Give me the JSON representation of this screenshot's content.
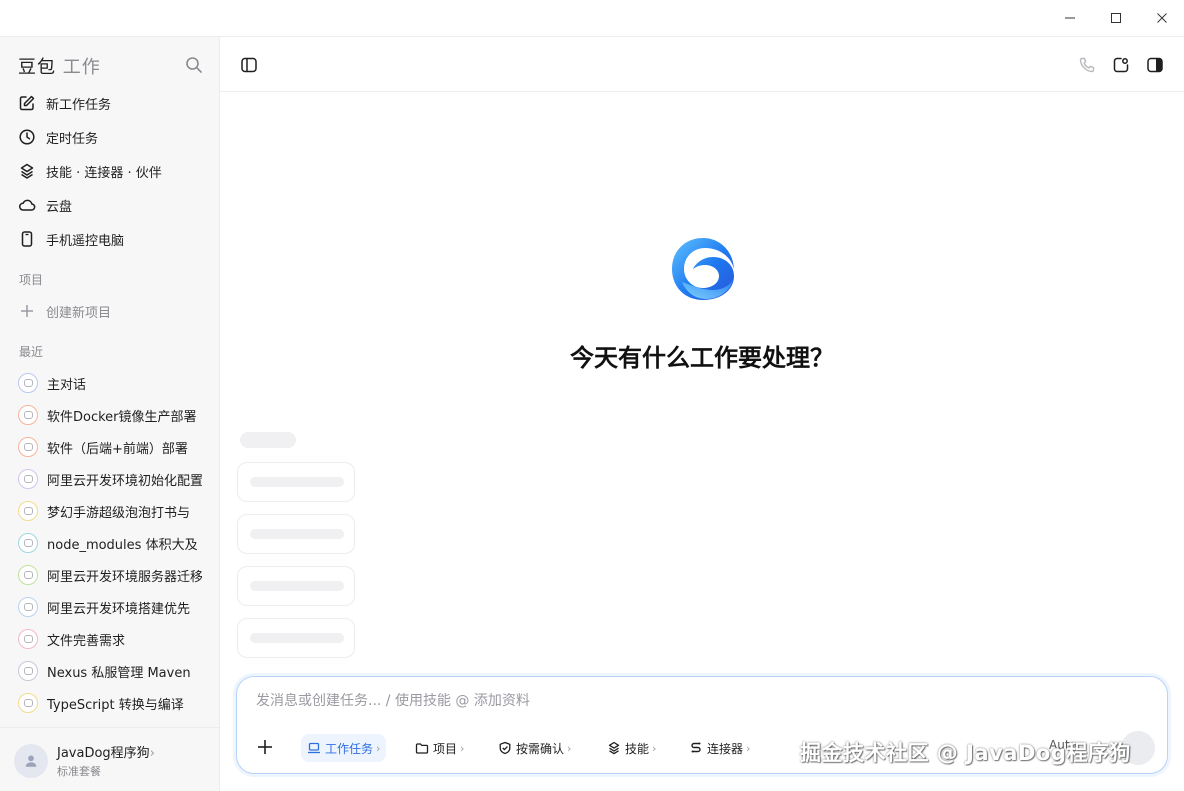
{
  "window": {
    "controls": [
      "minimize",
      "maximize",
      "close"
    ]
  },
  "sidebar": {
    "brand_main": "豆包",
    "brand_sub": "工作",
    "nav": [
      {
        "label": "新工作任务",
        "icon": "edit-icon"
      },
      {
        "label": "定时任务",
        "icon": "clock-icon"
      },
      {
        "label": "技能 · 连接器 · 伙伴",
        "icon": "layers-icon"
      },
      {
        "label": "云盘",
        "icon": "cloud-icon"
      },
      {
        "label": "手机遥控电脑",
        "icon": "phone-icon"
      }
    ],
    "projects_label": "项目",
    "create_project": "创建新项目",
    "recent_label": "最近",
    "recent": [
      {
        "label": "主对话",
        "color": "#b9c8f0"
      },
      {
        "label": "软件Docker镜像生产部署",
        "color": "#f5b49a"
      },
      {
        "label": "软件（后端+前端）部署",
        "color": "#f5b49a"
      },
      {
        "label": "阿里云开发环境初始化配置",
        "color": "#d4c2f0"
      },
      {
        "label": "梦幻手游超级泡泡打书与",
        "color": "#f0dc8c"
      },
      {
        "label": "node_modules 体积大及",
        "color": "#9fd6e0"
      },
      {
        "label": "阿里云开发环境服务器迁移",
        "color": "#bfe29c"
      },
      {
        "label": "阿里云开发环境搭建优先",
        "color": "#b9d2f0"
      },
      {
        "label": "文件完善需求",
        "color": "#f0b9c8"
      },
      {
        "label": "Nexus 私服管理 Maven",
        "color": "#c8c8d8"
      },
      {
        "label": "TypeScript 转换与编译",
        "color": "#f0dc8c"
      }
    ],
    "user": {
      "name": "JavaDog程序狗",
      "chevron": "›",
      "plan": "标准套餐"
    }
  },
  "main": {
    "headline": "今天有什么工作要处理？",
    "composer": {
      "placeholder": "发消息或创建任务... / 使用技能 @ 添加资料",
      "chips": [
        {
          "label": "工作任务",
          "icon": "laptop-icon",
          "active": true
        },
        {
          "label": "项目",
          "icon": "folder-icon",
          "active": false
        },
        {
          "label": "按需确认",
          "icon": "shield-check-icon",
          "active": false
        },
        {
          "label": "技能",
          "icon": "layers-icon",
          "active": false
        },
        {
          "label": "连接器",
          "icon": "link-icon",
          "active": false
        }
      ],
      "chip_chevron": "›",
      "model": "Auto"
    }
  },
  "watermark": "掘金技术社区 @ JavaDog程序狗",
  "colors": {
    "accent": "#2e6fe0",
    "logo_blue": "#1e78f0",
    "sidebar_bg": "#f7f7f8"
  }
}
